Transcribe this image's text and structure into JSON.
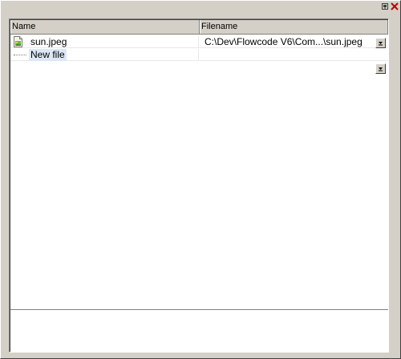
{
  "window": {
    "pin_icon": "pin-icon",
    "close_icon": "close-icon",
    "close_color": "#c00000"
  },
  "table": {
    "columns": [
      {
        "label": "Name"
      },
      {
        "label": "Filename"
      }
    ],
    "rows": [
      {
        "name": "sun.jpeg",
        "filename": "C:\\Dev\\Flowcode V6\\Com...\\sun.jpeg",
        "icon": "image-file-icon"
      },
      {
        "name": "New file",
        "filename": "",
        "icon": "tree-connector"
      }
    ]
  },
  "colors": {
    "window_bg": "#d4d0c8",
    "new_file_highlight": "#dce8f6"
  }
}
